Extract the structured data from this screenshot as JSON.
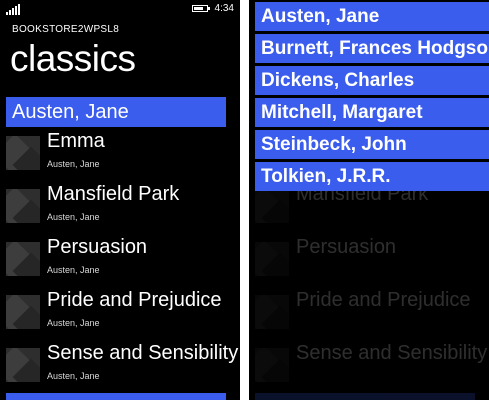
{
  "status": {
    "time": "4:34"
  },
  "app_title": "BOOKSTORE2WPSL8",
  "page_title": "classics",
  "group_header": "Austen, Jane",
  "books": [
    {
      "title": "Emma",
      "author": "Austen, Jane"
    },
    {
      "title": "Mansfield Park",
      "author": "Austen, Jane"
    },
    {
      "title": "Persuasion",
      "author": "Austen, Jane"
    },
    {
      "title": "Pride and Prejudice",
      "author": "Austen, Jane"
    },
    {
      "title": "Sense and Sensibility",
      "author": "Austen, Jane"
    }
  ],
  "jump_list": [
    "Austen, Jane",
    "Burnett, Frances Hodgson",
    "Dickens, Charles",
    "Mitchell, Margaret",
    "Steinbeck, John",
    "Tolkien, J.R.R."
  ],
  "colors": {
    "accent": "#3b5ded",
    "background": "#000000",
    "foreground": "#ffffff"
  }
}
